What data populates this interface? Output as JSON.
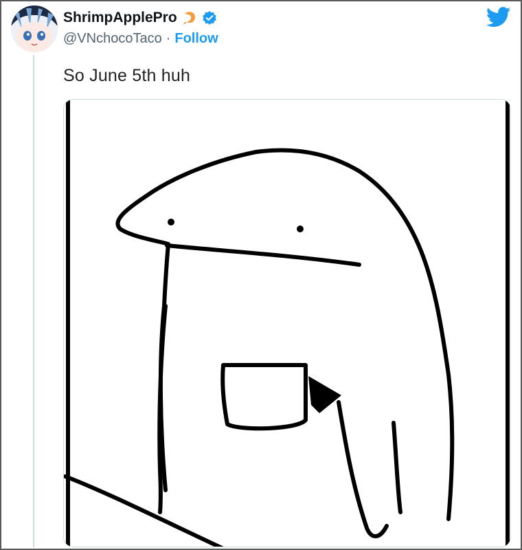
{
  "tweet": {
    "author": {
      "display_name": "ShrimpApplePro",
      "handle": "@VNchocoTaco",
      "emoji_icon": "shrimp-emoji-icon",
      "verified_icon": "verified-badge-icon",
      "avatar": "anime-avatar"
    },
    "separator": "·",
    "follow_label": "Follow",
    "text": "So June 5th huh",
    "brand_icon": "twitter-bird-icon",
    "media": {
      "type": "image",
      "description_icon": "blob-with-mug-drawing"
    }
  },
  "colors": {
    "accent": "#1d9bf0",
    "text_primary": "#0f1419",
    "text_secondary": "#536471",
    "border": "#cfd9de"
  }
}
